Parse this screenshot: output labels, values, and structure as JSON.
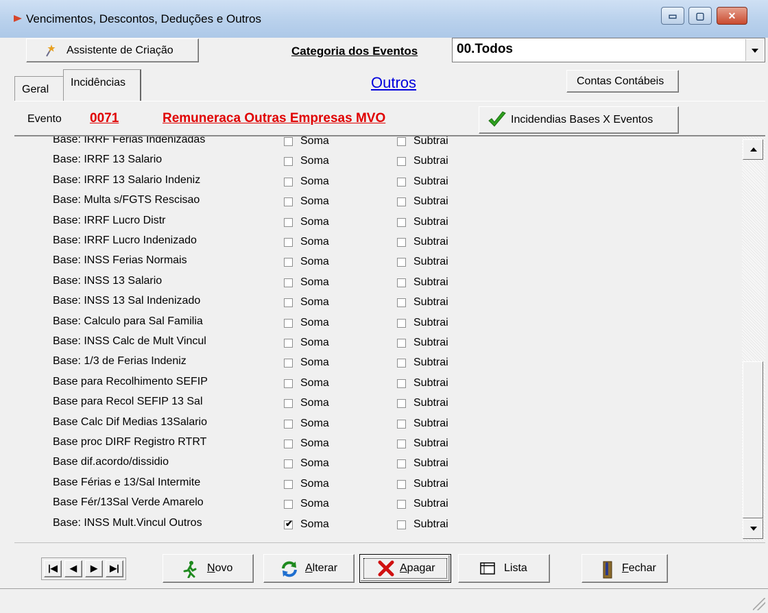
{
  "window": {
    "title": "Vencimentos, Descontos, Deduções e Outros",
    "min_glyph": "▭",
    "max_glyph": "▢",
    "close_glyph": "✕"
  },
  "toolbar": {
    "assistente_label": "Assistente de Criação",
    "categoria_label": "Categoria dos Eventos",
    "categoria_value": "00.Todos"
  },
  "tabs": {
    "geral": "Geral",
    "incidencias": "Incidências"
  },
  "section_title": "Outros",
  "contas_button": "Contas Contábeis",
  "evento": {
    "label": "Evento",
    "code": "0071",
    "name": "Remuneraca Outras Empresas MVO",
    "incid_button": "Incidendias Bases X Eventos"
  },
  "columns": {
    "soma": "Soma",
    "subtrai": "Subtrai"
  },
  "rows": [
    {
      "name": "Base: IRRF Ferias Indenizadas",
      "soma": false,
      "subtrai": false
    },
    {
      "name": "Base: IRRF 13 Salario",
      "soma": false,
      "subtrai": false
    },
    {
      "name": "Base: IRRF 13 Salario Indeniz",
      "soma": false,
      "subtrai": false
    },
    {
      "name": "Base: Multa s/FGTS Rescisao",
      "soma": false,
      "subtrai": false
    },
    {
      "name": "Base: IRRF Lucro Distr",
      "soma": false,
      "subtrai": false
    },
    {
      "name": "Base: IRRF Lucro Indenizado",
      "soma": false,
      "subtrai": false
    },
    {
      "name": "Base: INSS Ferias Normais",
      "soma": false,
      "subtrai": false
    },
    {
      "name": "Base: INSS 13 Salario",
      "soma": false,
      "subtrai": false
    },
    {
      "name": "Base: INSS 13 Sal Indenizado",
      "soma": false,
      "subtrai": false
    },
    {
      "name": "Base: Calculo para Sal Familia",
      "soma": false,
      "subtrai": false
    },
    {
      "name": "Base: INSS Calc de Mult Vincul",
      "soma": false,
      "subtrai": false
    },
    {
      "name": "Base: 1/3 de Ferias Indeniz",
      "soma": false,
      "subtrai": false
    },
    {
      "name": "Base para Recolhimento SEFIP",
      "soma": false,
      "subtrai": false
    },
    {
      "name": "Base para Recol SEFIP 13 Sal",
      "soma": false,
      "subtrai": false
    },
    {
      "name": "Base Calc Dif Medias 13Salario",
      "soma": false,
      "subtrai": false
    },
    {
      "name": "Base proc DIRF Registro RTRT",
      "soma": false,
      "subtrai": false
    },
    {
      "name": "Base dif.acordo/dissidio",
      "soma": false,
      "subtrai": false
    },
    {
      "name": "Base Férias e 13/Sal Intermite",
      "soma": false,
      "subtrai": false
    },
    {
      "name": "Base Fér/13Sal Verde Amarelo",
      "soma": false,
      "subtrai": false
    },
    {
      "name": "Base: INSS Mult.Vincul Outros",
      "soma": true,
      "subtrai": false
    }
  ],
  "nav": {
    "first": "|◀",
    "prev": "◀",
    "next": "▶",
    "last": "▶|"
  },
  "actions": {
    "novo": "Novo",
    "alterar": "Alterar",
    "apagar": "Apagar",
    "lista": "Lista",
    "fechar": "Fechar"
  },
  "colors": {
    "accent_red": "#e00000",
    "link_blue": "#0000dd",
    "check_green": "#2ea01f"
  }
}
